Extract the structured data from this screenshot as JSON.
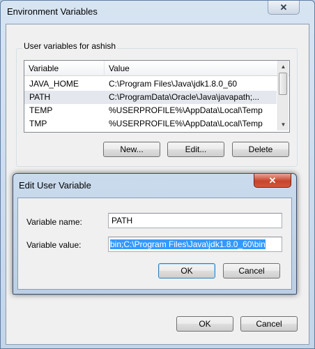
{
  "main": {
    "title": "Environment Variables",
    "close_glyph": "✕",
    "group_label": "User variables for ashish",
    "columns": [
      "Variable",
      "Value"
    ],
    "rows": [
      {
        "variable": "JAVA_HOME",
        "value": "C:\\Program Files\\Java\\jdk1.8.0_60"
      },
      {
        "variable": "PATH",
        "value": "C:\\ProgramData\\Oracle\\Java\\javapath;..."
      },
      {
        "variable": "TEMP",
        "value": "%USERPROFILE%\\AppData\\Local\\Temp"
      },
      {
        "variable": "TMP",
        "value": "%USERPROFILE%\\AppData\\Local\\Temp"
      }
    ],
    "buttons": {
      "new": "New...",
      "edit": "Edit...",
      "delete": "Delete"
    },
    "ok_label": "OK",
    "cancel_label": "Cancel"
  },
  "edit_dialog": {
    "title": "Edit User Variable",
    "close_glyph": "✕",
    "name_label": "Variable name:",
    "name_value": "PATH",
    "value_label": "Variable value:",
    "value_value": "bin;C:\\Program Files\\Java\\jdk1.8.0_60\\bin",
    "ok_label": "OK",
    "cancel_label": "Cancel"
  },
  "scrollbar": {
    "up": "▲",
    "down": "▼"
  },
  "colors": {
    "selection": "#3399ff",
    "close_red": "#c7442b"
  }
}
